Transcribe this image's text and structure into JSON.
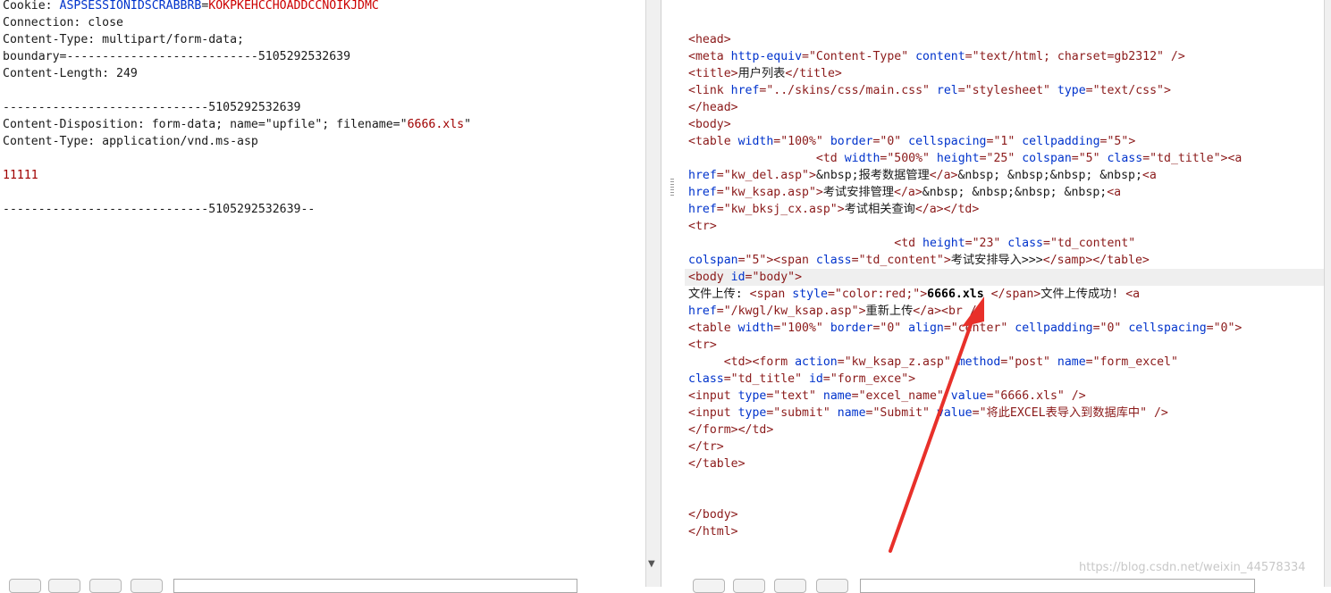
{
  "request": {
    "lines": [
      {
        "parts": [
          {
            "t": "Cookie: ",
            "c": "plain"
          },
          {
            "t": "ASPSESSIONIDSCRABBRB",
            "c": "cookie-name"
          },
          {
            "t": "=",
            "c": "plain"
          },
          {
            "t": "KOKPKEHCCHOADDCCNOIKJDMC",
            "c": "cookie-val"
          }
        ]
      },
      {
        "parts": [
          {
            "t": "Connection: close",
            "c": "plain"
          }
        ]
      },
      {
        "parts": [
          {
            "t": "Content-Type: multipart/form-data;",
            "c": "plain"
          }
        ]
      },
      {
        "parts": [
          {
            "t": "boundary=---------------------------5105292532639",
            "c": "plain"
          }
        ]
      },
      {
        "parts": [
          {
            "t": "Content-Length: 249",
            "c": "plain"
          }
        ]
      },
      {
        "parts": []
      },
      {
        "parts": [
          {
            "t": "-----------------------------5105292532639",
            "c": "plain"
          }
        ]
      },
      {
        "parts": [
          {
            "t": "Content-Disposition: form-data; name=\"upfile\"; filename=\"",
            "c": "plain"
          },
          {
            "t": "6666.xls",
            "c": "red"
          },
          {
            "t": "\"",
            "c": "plain"
          }
        ]
      },
      {
        "parts": [
          {
            "t": "Content-Type: application/vnd.ms-asp",
            "c": "plain"
          }
        ]
      },
      {
        "parts": []
      },
      {
        "parts": [
          {
            "t": "11111",
            "c": "red"
          }
        ]
      },
      {
        "parts": []
      },
      {
        "parts": [
          {
            "t": "-----------------------------5105292532639--",
            "c": "plain"
          }
        ]
      }
    ]
  },
  "response": {
    "lines": [
      {
        "parts": []
      },
      {
        "parts": []
      },
      {
        "parts": [
          {
            "t": "<head>",
            "c": "tag"
          }
        ]
      },
      {
        "parts": [
          {
            "t": "<meta ",
            "c": "tag"
          },
          {
            "t": "http-equiv",
            "c": "attr"
          },
          {
            "t": "=\"Content-Type\" ",
            "c": "val"
          },
          {
            "t": "content",
            "c": "attr"
          },
          {
            "t": "=\"text/html; charset=gb2312\"",
            "c": "val"
          },
          {
            "t": " />",
            "c": "tag"
          }
        ]
      },
      {
        "parts": [
          {
            "t": "<title>",
            "c": "tag"
          },
          {
            "t": "用户列表",
            "c": "plain"
          },
          {
            "t": "</title>",
            "c": "tag"
          }
        ]
      },
      {
        "parts": [
          {
            "t": "<link ",
            "c": "tag"
          },
          {
            "t": "href",
            "c": "attr"
          },
          {
            "t": "=\"../skins/css/main.css\" ",
            "c": "val"
          },
          {
            "t": "rel",
            "c": "attr"
          },
          {
            "t": "=\"stylesheet\" ",
            "c": "val"
          },
          {
            "t": "type",
            "c": "attr"
          },
          {
            "t": "=\"text/css\"",
            "c": "val"
          },
          {
            "t": ">",
            "c": "tag"
          }
        ]
      },
      {
        "parts": [
          {
            "t": "</head>",
            "c": "tag"
          }
        ]
      },
      {
        "parts": [
          {
            "t": "<body>",
            "c": "tag"
          }
        ]
      },
      {
        "parts": [
          {
            "t": "<table ",
            "c": "tag"
          },
          {
            "t": "width",
            "c": "attr"
          },
          {
            "t": "=\"100%\" ",
            "c": "val"
          },
          {
            "t": "border",
            "c": "attr"
          },
          {
            "t": "=\"0\" ",
            "c": "val"
          },
          {
            "t": "cellspacing",
            "c": "attr"
          },
          {
            "t": "=\"1\" ",
            "c": "val"
          },
          {
            "t": "cellpadding",
            "c": "attr"
          },
          {
            "t": "=\"5\"",
            "c": "val"
          },
          {
            "t": ">",
            "c": "tag"
          }
        ]
      },
      {
        "parts": [
          {
            "t": "                  ",
            "c": "plain"
          },
          {
            "t": "<td ",
            "c": "tag"
          },
          {
            "t": "width",
            "c": "attr"
          },
          {
            "t": "=\"500%\" ",
            "c": "val"
          },
          {
            "t": "height",
            "c": "attr"
          },
          {
            "t": "=\"25\" ",
            "c": "val"
          },
          {
            "t": "colspan",
            "c": "attr"
          },
          {
            "t": "=\"5\" ",
            "c": "val"
          },
          {
            "t": "class",
            "c": "attr"
          },
          {
            "t": "=\"td_title\"",
            "c": "val"
          },
          {
            "t": "><a",
            "c": "tag"
          }
        ]
      },
      {
        "parts": [
          {
            "t": "href",
            "c": "attr"
          },
          {
            "t": "=\"kw_del.asp\"",
            "c": "val"
          },
          {
            "t": ">",
            "c": "tag"
          },
          {
            "t": "&nbsp;报考数据管理",
            "c": "plain"
          },
          {
            "t": "</a>",
            "c": "tag"
          },
          {
            "t": "&nbsp; &nbsp;&nbsp; &nbsp;",
            "c": "plain"
          },
          {
            "t": "<a",
            "c": "tag"
          }
        ]
      },
      {
        "parts": [
          {
            "t": "href",
            "c": "attr"
          },
          {
            "t": "=\"kw_ksap.asp\"",
            "c": "val"
          },
          {
            "t": ">",
            "c": "tag"
          },
          {
            "t": "考试安排管理",
            "c": "plain"
          },
          {
            "t": "</a>",
            "c": "tag"
          },
          {
            "t": "&nbsp; &nbsp;&nbsp; &nbsp;",
            "c": "plain"
          },
          {
            "t": "<a",
            "c": "tag"
          }
        ]
      },
      {
        "parts": [
          {
            "t": "href",
            "c": "attr"
          },
          {
            "t": "=\"kw_bksj_cx.asp\"",
            "c": "val"
          },
          {
            "t": ">",
            "c": "tag"
          },
          {
            "t": "考试相关查询",
            "c": "plain"
          },
          {
            "t": "</a></td>",
            "c": "tag"
          }
        ]
      },
      {
        "parts": [
          {
            "t": "<tr>",
            "c": "tag"
          }
        ]
      },
      {
        "parts": [
          {
            "t": "                             ",
            "c": "plain"
          },
          {
            "t": "<td ",
            "c": "tag"
          },
          {
            "t": "height",
            "c": "attr"
          },
          {
            "t": "=\"23\" ",
            "c": "val"
          },
          {
            "t": "class",
            "c": "attr"
          },
          {
            "t": "=\"td_content\"",
            "c": "val"
          }
        ]
      },
      {
        "parts": [
          {
            "t": "colspan",
            "c": "attr"
          },
          {
            "t": "=\"5\"",
            "c": "val"
          },
          {
            "t": "><span ",
            "c": "tag"
          },
          {
            "t": "class",
            "c": "attr"
          },
          {
            "t": "=\"td_content\"",
            "c": "val"
          },
          {
            "t": ">",
            "c": "tag"
          },
          {
            "t": "考试安排导入>>>",
            "c": "plain"
          },
          {
            "t": "</samp></table>",
            "c": "tag"
          }
        ]
      },
      {
        "parts": [
          {
            "t": "<body ",
            "c": "tag"
          },
          {
            "t": "id",
            "c": "attr"
          },
          {
            "t": "=\"body\"",
            "c": "val"
          },
          {
            "t": ">",
            "c": "tag"
          }
        ],
        "highlight": true
      },
      {
        "parts": [
          {
            "t": "文件上传: ",
            "c": "plain"
          },
          {
            "t": "<span ",
            "c": "tag"
          },
          {
            "t": "style",
            "c": "attr"
          },
          {
            "t": "=\"color:red;\"",
            "c": "val"
          },
          {
            "t": ">",
            "c": "tag"
          },
          {
            "t": "6666.xls",
            "c": "strong"
          },
          {
            "t": " </span>",
            "c": "tag"
          },
          {
            "t": "文件上传成功! ",
            "c": "plain"
          },
          {
            "t": "<a",
            "c": "tag"
          }
        ]
      },
      {
        "parts": [
          {
            "t": "href",
            "c": "attr"
          },
          {
            "t": "=\"/kwgl/kw_ksap.asp\"",
            "c": "val"
          },
          {
            "t": ">",
            "c": "tag"
          },
          {
            "t": "重新上传",
            "c": "plain"
          },
          {
            "t": "</a><br />",
            "c": "tag"
          }
        ]
      },
      {
        "parts": [
          {
            "t": "<table ",
            "c": "tag"
          },
          {
            "t": "width",
            "c": "attr"
          },
          {
            "t": "=\"100%\" ",
            "c": "val"
          },
          {
            "t": "border",
            "c": "attr"
          },
          {
            "t": "=\"0\" ",
            "c": "val"
          },
          {
            "t": "align",
            "c": "attr"
          },
          {
            "t": "=\"center\" ",
            "c": "val"
          },
          {
            "t": "cellpadding",
            "c": "attr"
          },
          {
            "t": "=\"0\" ",
            "c": "val"
          },
          {
            "t": "cellspacing",
            "c": "attr"
          },
          {
            "t": "=\"0\"",
            "c": "val"
          },
          {
            "t": ">",
            "c": "tag"
          }
        ]
      },
      {
        "parts": [
          {
            "t": "<tr>",
            "c": "tag"
          }
        ]
      },
      {
        "parts": [
          {
            "t": "     ",
            "c": "plain"
          },
          {
            "t": "<td><form ",
            "c": "tag"
          },
          {
            "t": "action",
            "c": "attr"
          },
          {
            "t": "=\"kw_ksap_z.asp\" ",
            "c": "val"
          },
          {
            "t": "method",
            "c": "attr"
          },
          {
            "t": "=\"post\" ",
            "c": "val"
          },
          {
            "t": "name",
            "c": "attr"
          },
          {
            "t": "=\"form_excel\"",
            "c": "val"
          }
        ]
      },
      {
        "parts": [
          {
            "t": "class",
            "c": "attr"
          },
          {
            "t": "=\"td_title\" ",
            "c": "val"
          },
          {
            "t": "id",
            "c": "attr"
          },
          {
            "t": "=\"form_exce\"",
            "c": "val"
          },
          {
            "t": ">",
            "c": "tag"
          }
        ]
      },
      {
        "parts": [
          {
            "t": "<input ",
            "c": "tag"
          },
          {
            "t": "type",
            "c": "attr"
          },
          {
            "t": "=\"text\" ",
            "c": "val"
          },
          {
            "t": "name",
            "c": "attr"
          },
          {
            "t": "=\"excel_name\" ",
            "c": "val"
          },
          {
            "t": "value",
            "c": "attr"
          },
          {
            "t": "=\"6666.xls\"",
            "c": "val"
          },
          {
            "t": " />",
            "c": "tag"
          }
        ]
      },
      {
        "parts": [
          {
            "t": "<input ",
            "c": "tag"
          },
          {
            "t": "type",
            "c": "attr"
          },
          {
            "t": "=\"submit\" ",
            "c": "val"
          },
          {
            "t": "name",
            "c": "attr"
          },
          {
            "t": "=\"Submit\" ",
            "c": "val"
          },
          {
            "t": "value",
            "c": "attr"
          },
          {
            "t": "=\"将此EXCEL表导入到数据库中\"",
            "c": "val"
          },
          {
            "t": " />",
            "c": "tag"
          }
        ]
      },
      {
        "parts": [
          {
            "t": "</form></td>",
            "c": "tag"
          }
        ]
      },
      {
        "parts": [
          {
            "t": "</tr>",
            "c": "tag"
          }
        ]
      },
      {
        "parts": [
          {
            "t": "</table>",
            "c": "tag"
          }
        ]
      },
      {
        "parts": []
      },
      {
        "parts": []
      },
      {
        "parts": [
          {
            "t": "</body>",
            "c": "tag"
          }
        ]
      },
      {
        "parts": [
          {
            "t": "</html>",
            "c": "tag"
          }
        ]
      }
    ]
  },
  "watermark": "https://blog.csdn.net/weixin_44578334",
  "colors": {
    "arrow": "#e8302a",
    "tag": "#8b1a1a",
    "attr": "#0033cc"
  }
}
